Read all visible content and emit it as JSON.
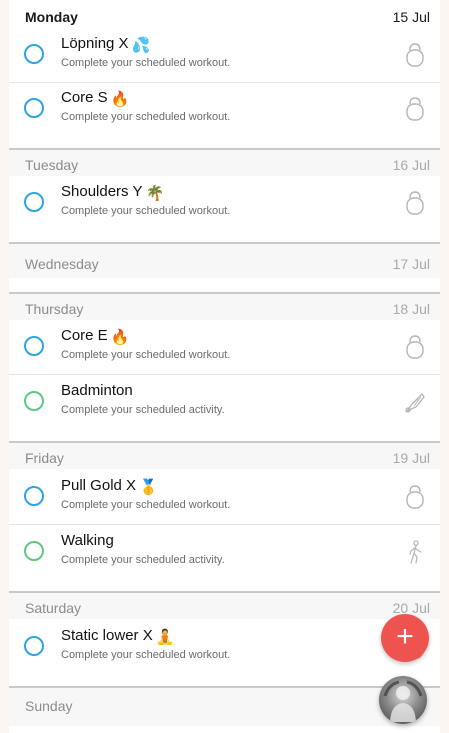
{
  "schedule": {
    "days": [
      {
        "name": "Monday",
        "date": "15 Jul",
        "items": [
          {
            "title": "Löpning X",
            "emoji": "💦",
            "subtitle": "Complete your scheduled workout.",
            "kind": "workout",
            "icon": "kettlebell-icon"
          },
          {
            "title": "Core S",
            "emoji": "🔥",
            "subtitle": "Complete your scheduled workout.",
            "kind": "workout",
            "icon": "kettlebell-icon"
          }
        ]
      },
      {
        "name": "Tuesday",
        "date": "16 Jul",
        "items": [
          {
            "title": "Shoulders Y",
            "emoji": "🌴",
            "subtitle": "Complete your scheduled workout.",
            "kind": "workout",
            "icon": "kettlebell-icon"
          }
        ]
      },
      {
        "name": "Wednesday",
        "date": "17 Jul",
        "items": []
      },
      {
        "name": "Thursday",
        "date": "18 Jul",
        "items": [
          {
            "title": "Core E",
            "emoji": "🔥",
            "subtitle": "Complete your scheduled workout.",
            "kind": "workout",
            "icon": "kettlebell-icon"
          },
          {
            "title": "Badminton",
            "emoji": "",
            "subtitle": "Complete your scheduled activity.",
            "kind": "activity",
            "icon": "shuttlecock-icon"
          }
        ]
      },
      {
        "name": "Friday",
        "date": "19 Jul",
        "items": [
          {
            "title": "Pull Gold X",
            "emoji": "🥇",
            "subtitle": "Complete your scheduled workout.",
            "kind": "workout",
            "icon": "kettlebell-icon"
          },
          {
            "title": "Walking",
            "emoji": "",
            "subtitle": "Complete your scheduled activity.",
            "kind": "activity",
            "icon": "walking-icon"
          }
        ]
      },
      {
        "name": "Saturday",
        "date": "20 Jul",
        "items": [
          {
            "title": "Static lower X",
            "emoji": "🧘",
            "subtitle": "Complete your scheduled workout.",
            "kind": "workout",
            "icon": "kettlebell-icon"
          }
        ]
      },
      {
        "name": "Sunday",
        "date": "",
        "items": []
      }
    ]
  },
  "fab": {
    "label": "+",
    "icon": "plus-icon",
    "color": "#ef5350"
  },
  "profile": {
    "icon": "avatar"
  },
  "colors": {
    "workout_circle": "#2ea3e6",
    "activity_circle": "#5fc784",
    "background": "#fcf5f0"
  }
}
